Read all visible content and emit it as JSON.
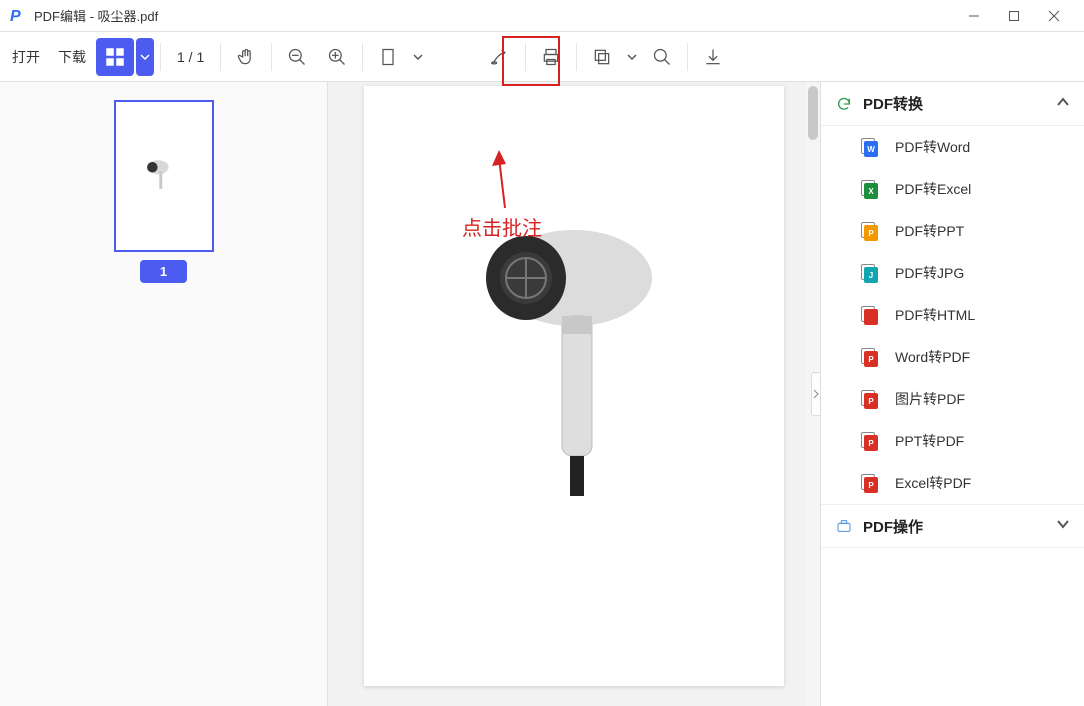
{
  "title": "PDF编辑 - 吸尘器.pdf",
  "toolbar": {
    "open": "打开",
    "download": "下载",
    "page_indicator": "1 / 1"
  },
  "thumbnail": {
    "page_number": "1"
  },
  "annotation_arrow_text": "点击批注",
  "sidebar": {
    "section1": {
      "title": "PDF转换",
      "items": [
        {
          "label": "PDF转Word",
          "color": "c-blue",
          "glyph": "W"
        },
        {
          "label": "PDF转Excel",
          "color": "c-green",
          "glyph": "X"
        },
        {
          "label": "PDF转PPT",
          "color": "c-orange",
          "glyph": "P"
        },
        {
          "label": "PDF转JPG",
          "color": "c-teal",
          "glyph": "J"
        },
        {
          "label": "PDF转HTML",
          "color": "c-red",
          "glyph": "</>"
        },
        {
          "label": "Word转PDF",
          "color": "c-red",
          "glyph": "P"
        },
        {
          "label": "图片转PDF",
          "color": "c-red",
          "glyph": "P"
        },
        {
          "label": "PPT转PDF",
          "color": "c-red",
          "glyph": "P"
        },
        {
          "label": "Excel转PDF",
          "color": "c-red",
          "glyph": "P"
        }
      ]
    },
    "section2": {
      "title": "PDF操作"
    }
  }
}
